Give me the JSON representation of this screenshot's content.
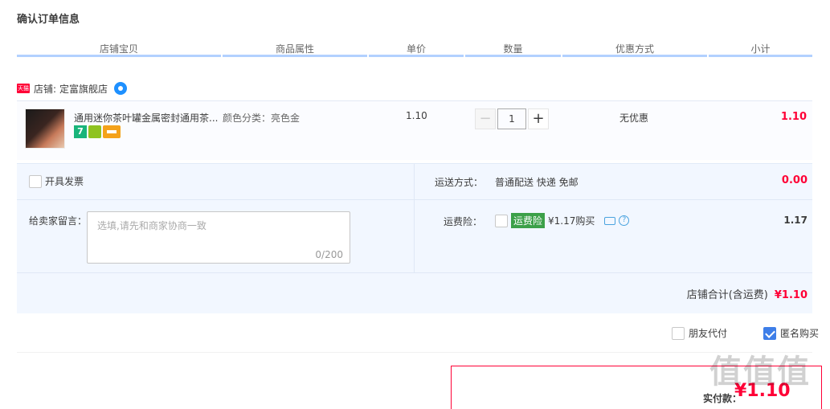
{
  "page": {
    "title": "确认订单信息"
  },
  "columns": [
    "店铺宝贝",
    "商品属性",
    "单价",
    "数量",
    "优惠方式",
    "小计"
  ],
  "shop": {
    "badge": "天猫",
    "label": "店铺:",
    "name": "定富旗舰店"
  },
  "item": {
    "title": "通用迷你茶叶罐金属密封通用茶...",
    "attr": "颜色分类：亮色金",
    "price": "1.10",
    "quantity": "1",
    "qty_minus": "−",
    "qty_plus": "+",
    "promo": "无优惠",
    "subtotal": "1.10",
    "icons": [
      "7-day-return-icon",
      "guarantee-shield-icon",
      "credit-card-icon"
    ]
  },
  "invoice": {
    "label": "开具发票",
    "checked": false
  },
  "note": {
    "label": "给卖家留言：",
    "placeholder": "选填,请先和商家协商一致",
    "counter": "0/200"
  },
  "shipping": {
    "label": "运送方式：",
    "value": "普通配送 快递 免邮",
    "price": "0.00"
  },
  "insurance": {
    "label": "运费险：",
    "badge": "运费险",
    "text": "¥1.17购买",
    "price": "1.17",
    "help": "?"
  },
  "shop_total": {
    "label": "店铺合计(含运费)",
    "value": "¥1.10"
  },
  "options": {
    "friend_pay": "朋友代付",
    "anonymous": "匿名购买",
    "anonymous_checked": true
  },
  "pay": {
    "label": "实付款：",
    "value": "¥1.10"
  },
  "watermark": "值值值",
  "colors": {
    "accent_red": "#ff0036",
    "header_line": "#b2d1ff",
    "panel_bg": "#f2f7ff",
    "check_blue": "#3e7ee8",
    "ins_green": "#3ca048"
  }
}
